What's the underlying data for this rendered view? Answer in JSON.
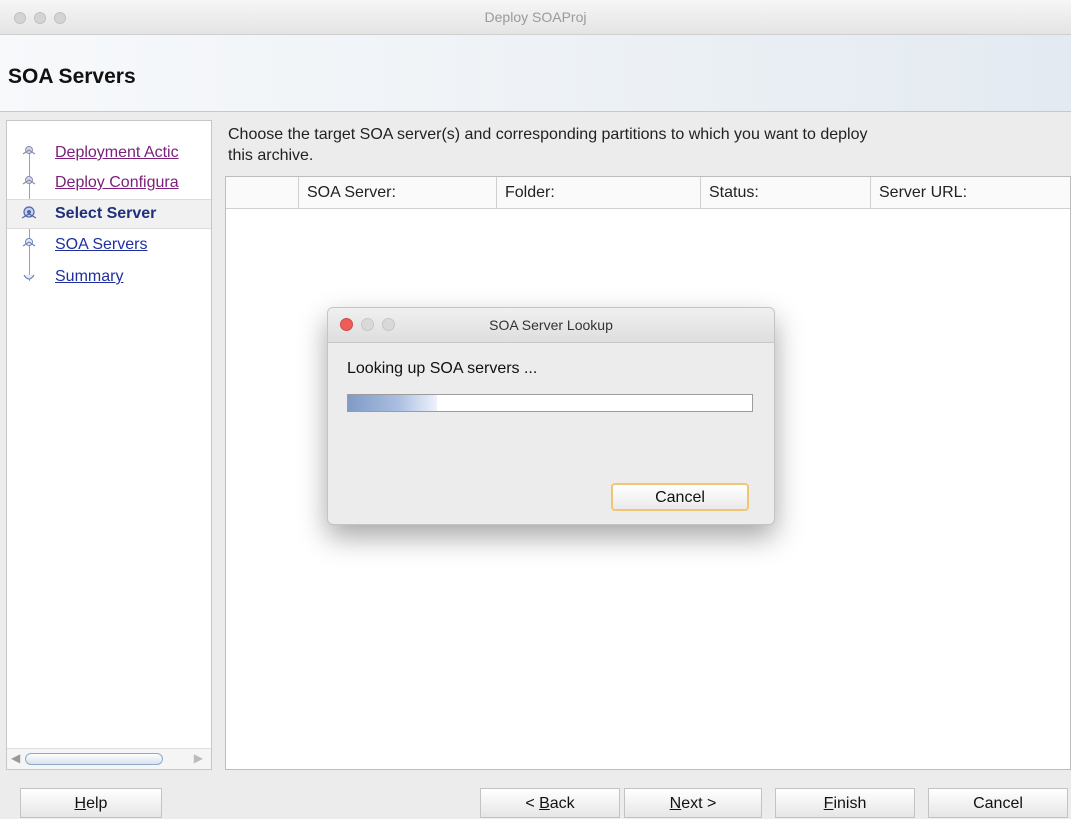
{
  "window": {
    "title": "Deploy SOAProj"
  },
  "header": {
    "title": "SOA Servers"
  },
  "nav": {
    "items": [
      {
        "label": "Deployment Actic",
        "state": "visited"
      },
      {
        "label": "Deploy Configura",
        "state": "visited"
      },
      {
        "label": "Select Server",
        "state": "current"
      },
      {
        "label": "SOA Servers",
        "state": "link"
      },
      {
        "label": "Summary",
        "state": "link"
      }
    ]
  },
  "main": {
    "instruction_line1": "Choose the target SOA server(s) and corresponding partitions to which you want to deploy",
    "instruction_line2": "this archive.",
    "table": {
      "columns": [
        "",
        "SOA Server:",
        "Folder:",
        "Status:",
        "Server URL:"
      ]
    }
  },
  "dialog": {
    "title": "SOA Server Lookup",
    "message": "Looking up SOA servers ...",
    "progress": 0.22,
    "cancel_label": "Cancel"
  },
  "footer": {
    "help_mnemonic": "H",
    "help_rest": "elp",
    "back_prefix": "< ",
    "back_mnemonic": "B",
    "back_rest": "ack",
    "next_mnemonic": "N",
    "next_rest": "ext >",
    "finish_mnemonic": "F",
    "finish_rest": "inish",
    "cancel_label": "Cancel"
  },
  "colors": {
    "visited_link": "#7a1f7a",
    "link": "#1f2f9e",
    "dialog_close": "#ee5e59",
    "default_button_border": "#f0c674"
  }
}
